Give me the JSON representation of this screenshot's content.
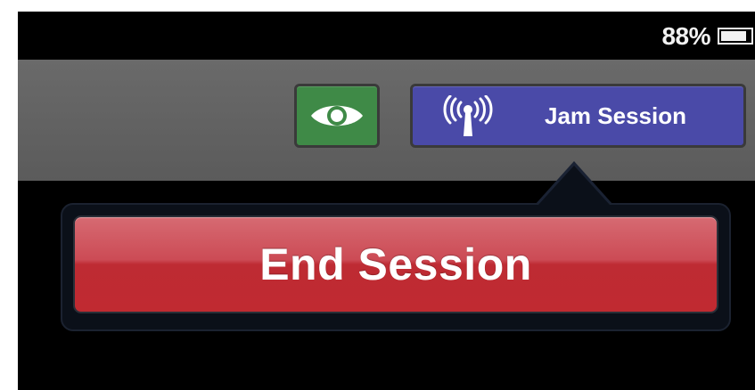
{
  "status_bar": {
    "battery_percent": "88%",
    "battery_level": 0.88
  },
  "toolbar": {
    "eye_button": {
      "icon": "eye-icon",
      "color": "#3f8a47"
    },
    "jam_button": {
      "icon": "antenna-icon",
      "label": "Jam Session",
      "color": "#4a4aa8"
    }
  },
  "popover": {
    "end_session_label": "End Session",
    "button_color": "#c02a31"
  }
}
